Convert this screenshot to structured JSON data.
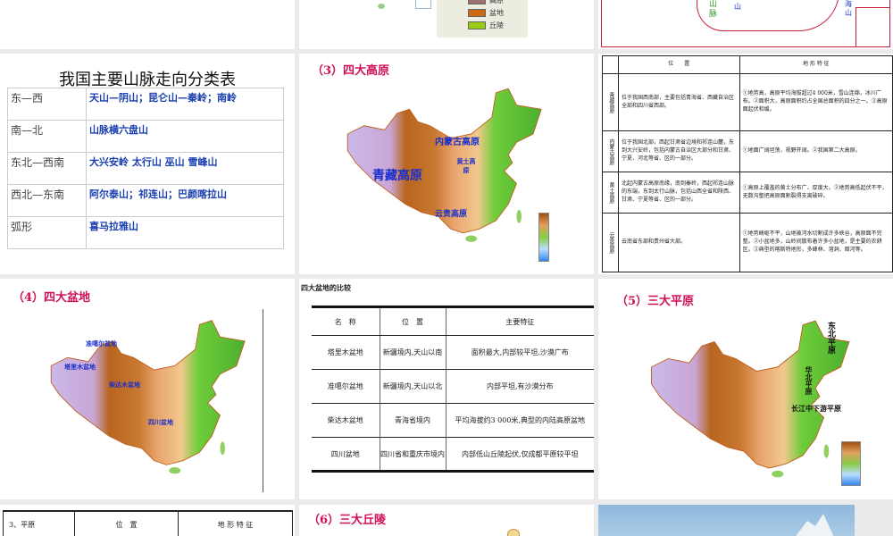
{
  "colors": {
    "background": "#ebebeb",
    "title_accent": "#d0105a",
    "label_blue": "#1a2fcc"
  },
  "slide2_legend": {
    "items": [
      {
        "label": "高原",
        "color": "#a07070"
      },
      {
        "label": "盆地",
        "color": "#cc6a10"
      },
      {
        "label": "丘陵",
        "color": "#99cc11"
      }
    ]
  },
  "slide3_map": {
    "labels": [
      "山",
      "脉",
      "山",
      "海",
      "山"
    ]
  },
  "mountain_table": {
    "title": "我国主要山脉走向分类表",
    "rows": [
      {
        "dir": "东—西",
        "names": "天山—阴山；昆仑山—秦岭；南岭"
      },
      {
        "dir": "南—北",
        "names": "山脉横六盘山"
      },
      {
        "dir": "东北—西南",
        "names": "大兴安岭 太行山 巫山 雪峰山"
      },
      {
        "dir": "西北—东南",
        "names": "阿尔泰山；祁连山；巴颜喀拉山"
      },
      {
        "dir": "弧形",
        "names": "喜马拉雅山"
      }
    ]
  },
  "plateau_map": {
    "title": "（3）四大高原",
    "labels": [
      "内蒙古高原",
      "黄土高原",
      "青藏高原",
      "云贵高原"
    ]
  },
  "plateau_table": {
    "headers": [
      "",
      "位　　置",
      "地 形 特 征"
    ],
    "rows": [
      {
        "name": "青藏高原",
        "loc": "位于我国西南部，主要包括青海省、西藏自治区全部和四川省西部。",
        "feat": "①地势高，高原平均海拔超过4 000米，雪山连绵，冰川广布。②面积大，高原面积约占全国总面积的四分之一。③高原面起伏和缓。"
      },
      {
        "name": "内蒙古高原",
        "loc": "位于我国北部，西起甘肃省边境和祁连山麓，东到大兴安岭，包括内蒙古自治区大部分和甘肃、宁夏、河北等省、区的一部分。",
        "feat": "①地面广阔坦荡，视野开阔。②我国第二大高原。"
      },
      {
        "name": "黄土高原",
        "loc": "北起内蒙古高原南缘，南到秦岭，西起祁连山脉的东端，东到太行山脉，包括山西全省和陕西、甘肃、宁夏等省、区的一部分。",
        "feat": "①高原上覆盖的黄土分布广、厚度大。②地势高低起伏不平，无数沟壑把高原面割裂得支离破碎。"
      },
      {
        "name": "云贵高原",
        "loc": "云南省东部和贵州省大部。",
        "feat": "①地势崎岖不平，山地被河水切割成许多峡谷，高原面不完整。②小盆地多，山岭间散布着许多小盆地，是主要的农耕区。③典型的喀斯特地形，多峰林、溶洞、暗河等。"
      }
    ]
  },
  "basin_map": {
    "title": "（4）四大盆地",
    "labels": [
      "准噶尔盆地",
      "塔里木盆地",
      "柴达木盆地",
      "四川盆地"
    ]
  },
  "basin_table": {
    "caption": "四大盆地的比较",
    "headers": [
      "名　称",
      "位　置",
      "主要特征"
    ],
    "rows": [
      [
        "塔里木盆地",
        "新疆境内,天山以南",
        "面积最大,内部较平坦,沙漠广布"
      ],
      [
        "准噶尔盆地",
        "新疆境内,天山以北",
        "内部平坦,有沙漠分布"
      ],
      [
        "柴达木盆地",
        "青海省境内",
        "平均海拔约3 000米,典型的内陆高原盆地"
      ],
      [
        "四川盆地",
        "四川省和重庆市境内",
        "内部低山丘陵起伏,仅成都平原较平坦"
      ]
    ]
  },
  "plain_map": {
    "title": "（5）三大平原",
    "labels": [
      "东北平原",
      "华北平原",
      "长江中下游平原"
    ]
  },
  "plain_table": {
    "headers": [
      "3、平原",
      "位　置",
      "地 形 特 征"
    ]
  },
  "hill_map": {
    "title": "（6）三大丘陵"
  }
}
